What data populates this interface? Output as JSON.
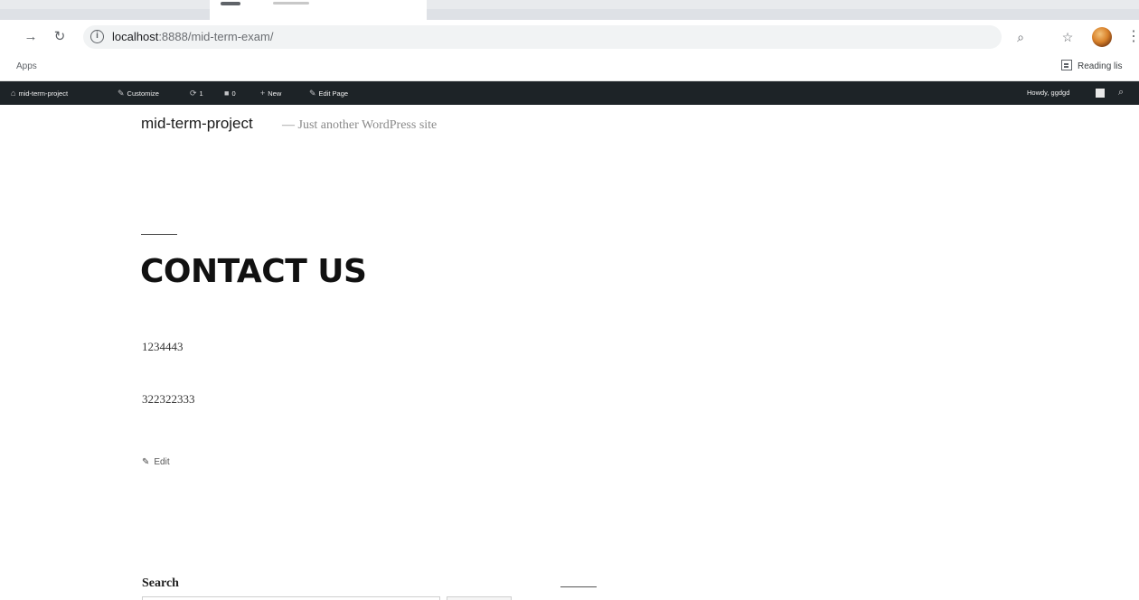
{
  "browser": {
    "url_host": "localhost",
    "url_rest": ":8888/mid-term-exam/",
    "bookmarks_apps": "Apps",
    "reading_list": "Reading lis"
  },
  "adminbar": {
    "site": "mid-term-project",
    "customize": "Customize",
    "updates": "1",
    "comments": "0",
    "new": "New",
    "edit_page": "Edit Page",
    "howdy": "Howdy, ggdgd"
  },
  "site": {
    "title": "mid-term-project",
    "tagline": "— Just another WordPress site"
  },
  "content": {
    "heading": "CONTACT US",
    "paragraphs": [
      "1234443",
      "322322333"
    ],
    "edit": "Edit"
  },
  "widget": {
    "search_label": "Search"
  },
  "icons": {
    "back": "back-arrow-icon",
    "reload": "reload-icon",
    "info": "info-icon",
    "zoom": "zoom-icon",
    "star": "star-icon",
    "menu": "kebab-menu-icon",
    "reading_list": "reading-list-icon",
    "wordpress": "wordpress-icon",
    "pencil": "pencil-icon",
    "search": "search-icon"
  },
  "colors": {
    "adminbar_bg": "#1d2327",
    "adminbar_text": "#f0f0f1",
    "omnibox_bg": "#f1f3f4"
  }
}
